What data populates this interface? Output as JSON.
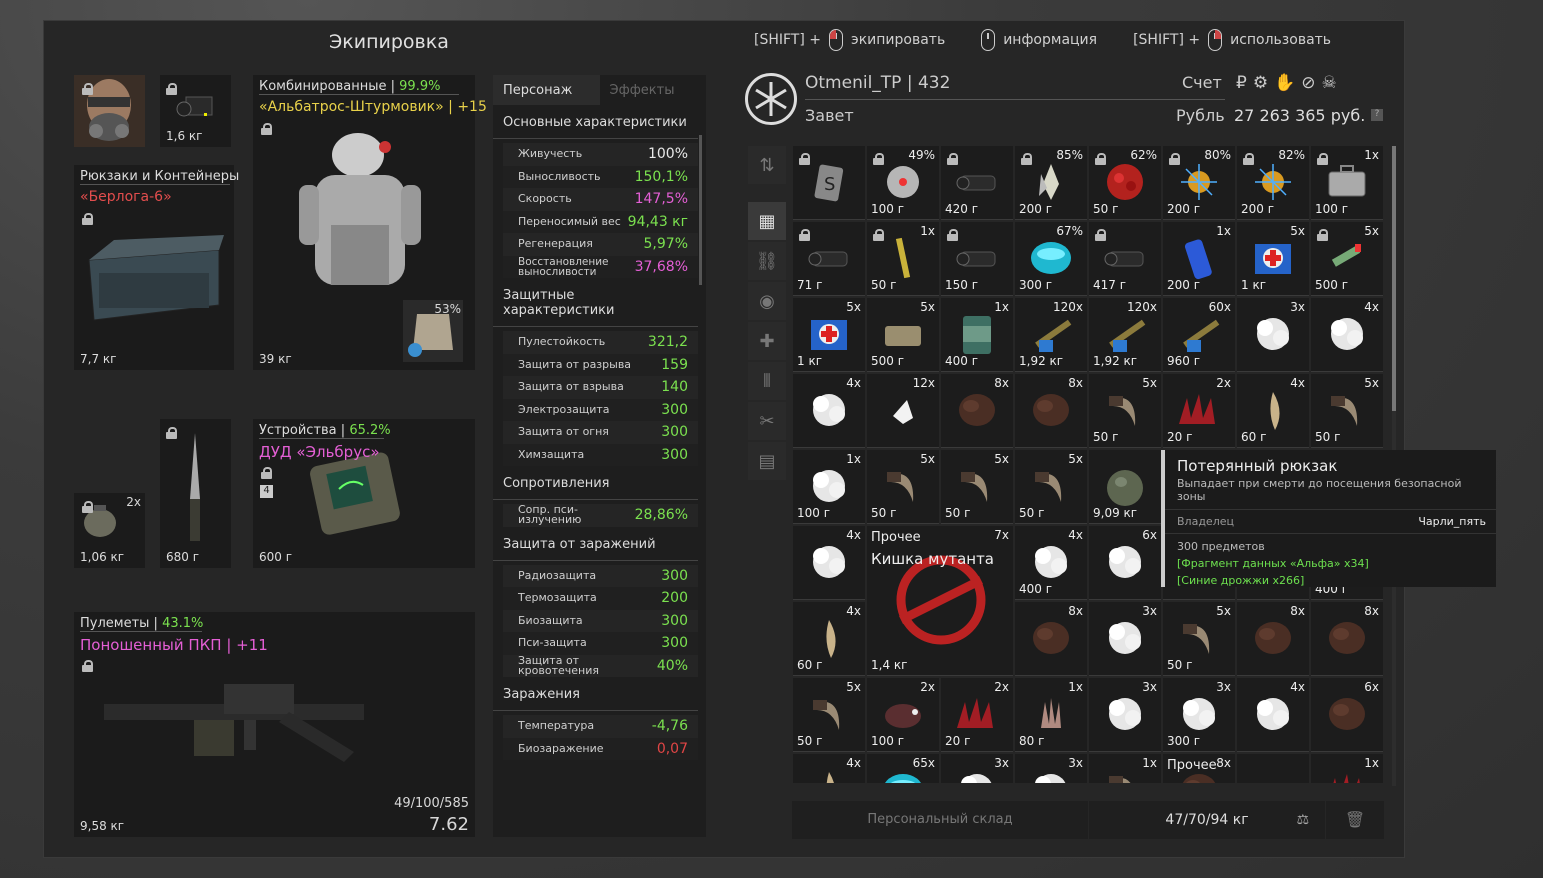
{
  "title": "Экипировка",
  "hints": {
    "equip": {
      "prefix": "[SHIFT] +",
      "label": "экипировать"
    },
    "info": {
      "label": "информация"
    },
    "use": {
      "prefix": "[SHIFT] +",
      "label": "использовать"
    }
  },
  "slots": {
    "helmet_weight": "1,6 кг",
    "backpack": {
      "category": "Рюкзаки и Контейнеры",
      "name": "«Берлога-6»",
      "weight": "7,7 кг"
    },
    "armor": {
      "category": "Комбинированные",
      "percent": "99.9%",
      "name": "«Альбатрос-Штурмовик» | +15",
      "weight": "39 кг",
      "plate_percent": "53%"
    },
    "grenade": {
      "count": "2x",
      "weight": "1,06 кг"
    },
    "knife": {
      "weight": "680 г"
    },
    "device": {
      "category": "Устройства",
      "percent": "65.2%",
      "name": "ДУД «Эльбрус»",
      "weight": "600 г",
      "badge": "4"
    },
    "weapon": {
      "category": "Пулеметы",
      "percent": "43.1%",
      "name": "Поношенный ПКП | +11",
      "ammo": "49/100/585",
      "caliber": "7.62",
      "weight": "9,58 кг"
    }
  },
  "stats": {
    "tabs": [
      "Персонаж",
      "Эффекты"
    ],
    "main_head": "Основные характеристики",
    "main": [
      {
        "k": "Живучесть",
        "v": "100%",
        "c": "white"
      },
      {
        "k": "Выносливость",
        "v": "150,1%",
        "c": "green"
      },
      {
        "k": "Скорость",
        "v": "147,5%",
        "c": "pink"
      },
      {
        "k": "Переносимый вес",
        "v": "94,43 кг",
        "c": "green"
      },
      {
        "k": "Регенерация",
        "v": "5,97%",
        "c": "green"
      },
      {
        "k": "Восстановление выносливости",
        "v": "37,68%",
        "c": "pink"
      }
    ],
    "prot_head": "Защитные характеристики",
    "prot": [
      {
        "k": "Пулестойкость",
        "v": "321,2"
      },
      {
        "k": "Защита от разрыва",
        "v": "159"
      },
      {
        "k": "Защита от взрыва",
        "v": "140"
      },
      {
        "k": "Электрозащита",
        "v": "300"
      },
      {
        "k": "Защита от огня",
        "v": "300"
      },
      {
        "k": "Химзащита",
        "v": "300"
      }
    ],
    "res_head": "Сопротивления",
    "res": [
      {
        "k": "Сопр. пси-излучению",
        "v": "28,86%"
      }
    ],
    "inf_prot_head": "Защита от заражений",
    "inf_prot": [
      {
        "k": "Радиозащита",
        "v": "300"
      },
      {
        "k": "Термозащита",
        "v": "200"
      },
      {
        "k": "Биозащита",
        "v": "300"
      },
      {
        "k": "Пси-защита",
        "v": "300"
      },
      {
        "k": "Защита от кровотечения",
        "v": "40%"
      }
    ],
    "inf_head": "Заражения",
    "inf": [
      {
        "k": "Температура",
        "v": "-4,76",
        "c": "green"
      },
      {
        "k": "Биозаражение",
        "v": "0,07",
        "c": "red"
      }
    ]
  },
  "player": {
    "name": "Otmenil_TP",
    "level": "432",
    "clan": "Завет",
    "account_label": "Счет",
    "currency_label": "Рубль",
    "money": "27 263 365 руб.",
    "help": "?"
  },
  "footer": {
    "storage": "Персональный склад",
    "weight": "47/70/94 кг"
  },
  "tooltip": {
    "title": "Потерянный рюкзак",
    "desc": "Выпадает при смерти до посещения безопасной зоны",
    "owner_label": "Владелец",
    "owner": "Чарли_пять",
    "count": "300 предметов",
    "line1": "[Фрагмент данных «Альфа» x34]",
    "line2": "[Синие дрожжи x266]"
  },
  "grid": [
    [
      {
        "q": "",
        "p": "",
        "i": "tag",
        "l": true
      },
      {
        "q": "49%",
        "p": "100 г",
        "i": "orb-white",
        "l": true
      },
      {
        "q": "",
        "p": "420 г",
        "i": "scope",
        "l": true
      },
      {
        "q": "85%",
        "p": "200 г",
        "i": "crystal",
        "l": true
      },
      {
        "q": "62%",
        "p": "50 г",
        "i": "coral",
        "l": true
      },
      {
        "q": "80%",
        "p": "200 г",
        "i": "gold",
        "l": true
      },
      {
        "q": "82%",
        "p": "200 г",
        "i": "gold",
        "l": true
      },
      {
        "q": "1x",
        "p": "100 г",
        "i": "case",
        "l": true
      }
    ],
    [
      {
        "q": "",
        "p": "71 г",
        "i": "scope",
        "l": true
      },
      {
        "q": "1x",
        "p": "50 г",
        "i": "stick",
        "l": true
      },
      {
        "q": "",
        "p": "150 г",
        "i": "scope",
        "l": true
      },
      {
        "q": "67%",
        "p": "300 г",
        "i": "cyan",
        "l": false
      },
      {
        "q": "",
        "p": "417 г",
        "i": "scope",
        "l": true
      },
      {
        "q": "1x",
        "p": "200 г",
        "i": "blue",
        "l": false
      },
      {
        "q": "5x",
        "p": "1 кг",
        "i": "medkit",
        "l": false
      },
      {
        "q": "5x",
        "p": "500 г",
        "i": "syringe",
        "l": true
      }
    ],
    [
      {
        "q": "5x",
        "p": "1 кг",
        "i": "medkit",
        "l": false
      },
      {
        "q": "5x",
        "p": "500 г",
        "i": "bar",
        "l": false
      },
      {
        "q": "1x",
        "p": "400 г",
        "i": "can",
        "l": false
      },
      {
        "q": "120x",
        "p": "1,92 кг",
        "i": "ammo",
        "l": false
      },
      {
        "q": "120x",
        "p": "1,92 кг",
        "i": "ammo",
        "l": false
      },
      {
        "q": "60x",
        "p": "960 г",
        "i": "ammo",
        "l": false
      },
      {
        "q": "3x",
        "p": "",
        "i": "cloud",
        "l": false
      },
      {
        "q": "4x",
        "p": "",
        "i": "cloud",
        "l": false
      }
    ],
    [
      {
        "q": "4x",
        "p": "",
        "i": "cloud",
        "l": false
      },
      {
        "q": "12x",
        "p": "",
        "i": "shard",
        "l": false
      },
      {
        "q": "8x",
        "p": "",
        "i": "fur",
        "l": false
      },
      {
        "q": "8x",
        "p": "",
        "i": "fur",
        "l": false
      },
      {
        "q": "5x",
        "p": "50 г",
        "i": "claw",
        "l": false
      },
      {
        "q": "2x",
        "p": "20 г",
        "i": "spikes",
        "l": false
      },
      {
        "q": "4x",
        "p": "60 г",
        "i": "tusk",
        "l": false
      },
      {
        "q": "5x",
        "p": "50 г",
        "i": "claw",
        "l": false
      }
    ],
    [
      {
        "q": "1x",
        "p": "100 г",
        "i": "cloud",
        "l": false
      },
      {
        "q": "5x",
        "p": "50 г",
        "i": "claw",
        "l": false
      },
      {
        "q": "5x",
        "p": "50 г",
        "i": "claw",
        "l": false
      },
      {
        "q": "5x",
        "p": "50 г",
        "i": "claw",
        "l": false
      },
      {
        "q": "",
        "p": "9,09 кг",
        "i": "bag",
        "l": false
      },
      {
        "q": "",
        "p": "",
        "i": "empty",
        "l": false
      },
      {
        "q": "",
        "p": "",
        "i": "empty",
        "l": false
      },
      {
        "q": "",
        "p": "",
        "i": "empty",
        "l": false
      }
    ],
    [
      {
        "q": "4x",
        "p": "",
        "i": "cloud",
        "l": false
      },
      {
        "q": "7x",
        "p": "1,4 кг",
        "i": "gut",
        "l": false,
        "big": true,
        "label": "Прочее",
        "sub": "Кишка мутанта"
      },
      null,
      {
        "q": "4x",
        "p": "400 г",
        "i": "cloud",
        "l": false
      },
      {
        "q": "6x",
        "p": "",
        "i": "cloud",
        "l": false
      },
      {
        "q": "",
        "p": "",
        "i": "empty",
        "l": false
      },
      {
        "q": "",
        "p": "",
        "i": "empty",
        "l": false
      },
      {
        "q": "",
        "p": "400 г",
        "i": "empty",
        "l": false
      }
    ],
    [
      {
        "q": "4x",
        "p": "60 г",
        "i": "tusk",
        "l": false
      },
      null,
      null,
      {
        "q": "8x",
        "p": "",
        "i": "fur",
        "l": false
      },
      {
        "q": "3x",
        "p": "",
        "i": "cloud",
        "l": false
      },
      {
        "q": "5x",
        "p": "50 г",
        "i": "claw",
        "l": false
      },
      {
        "q": "8x",
        "p": "",
        "i": "fur",
        "l": false
      },
      {
        "q": "8x",
        "p": "",
        "i": "fur",
        "l": false
      }
    ],
    [
      {
        "q": "5x",
        "p": "50 г",
        "i": "claw",
        "l": false
      },
      {
        "q": "2x",
        "p": "100 г",
        "i": "head",
        "l": false
      },
      {
        "q": "2x",
        "p": "20 г",
        "i": "spikes",
        "l": false
      },
      {
        "q": "1x",
        "p": "80 г",
        "i": "hand",
        "l": false
      },
      {
        "q": "3x",
        "p": "",
        "i": "cloud",
        "l": false
      },
      {
        "q": "3x",
        "p": "300 г",
        "i": "cloud",
        "l": false
      },
      {
        "q": "4x",
        "p": "",
        "i": "cloud",
        "l": false
      },
      {
        "q": "6x",
        "p": "",
        "i": "fur",
        "l": false
      }
    ],
    [
      {
        "q": "4x",
        "p": "",
        "i": "tusk",
        "l": false
      },
      {
        "q": "65x",
        "p": "",
        "i": "cyan",
        "l": false
      },
      {
        "q": "3x",
        "p": "",
        "i": "cloud",
        "l": false
      },
      {
        "q": "3x",
        "p": "",
        "i": "cloud",
        "l": false
      },
      {
        "q": "1x",
        "p": "",
        "i": "claw",
        "l": false
      },
      {
        "q": "8x",
        "p": "",
        "i": "fur",
        "l": false,
        "label": "Прочее"
      },
      {
        "q": "",
        "p": "",
        "i": "empty",
        "l": false
      },
      {
        "q": "1x",
        "p": "",
        "i": "spikes",
        "l": false
      }
    ]
  ]
}
